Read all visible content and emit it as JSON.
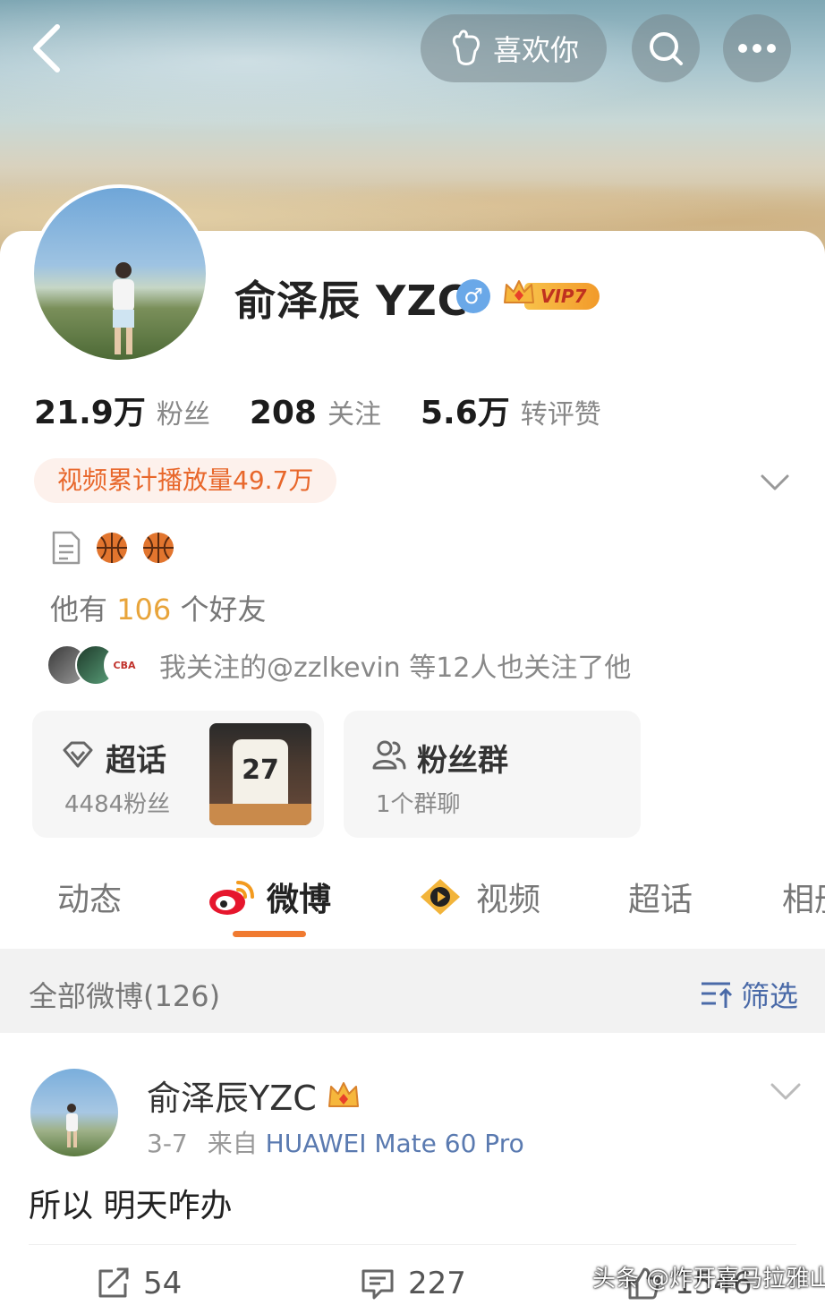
{
  "header": {
    "like_label": "喜欢你"
  },
  "profile": {
    "name": "俞泽辰 YZC",
    "gender_symbol": "♂",
    "vip_label": "VIP7",
    "stats": [
      {
        "num": "21.9万",
        "label": "粉丝"
      },
      {
        "num": "208",
        "label": "关注"
      },
      {
        "num": "5.6万",
        "label": "转评赞"
      }
    ],
    "play_tag": "视频累计播放量49.7万",
    "friends_prefix": "他有 ",
    "friends_count": "106",
    "friends_suffix": " 个好友",
    "mutual_text": "我关注的@zzlkevin 等12人也关注了他",
    "mutual_badge": "CBA"
  },
  "cards": {
    "super_topic": {
      "title": "超话",
      "sub": "4484粉丝",
      "jersey_number": "27"
    },
    "fan_group": {
      "title": "粉丝群",
      "sub": "1个群聊"
    }
  },
  "tabs": [
    {
      "label": "动态"
    },
    {
      "label": "微博"
    },
    {
      "label": "视频"
    },
    {
      "label": "超话"
    },
    {
      "label": "相册"
    }
  ],
  "filterbar": {
    "all_label": "全部微博(126)",
    "filter_label": "筛选"
  },
  "post": {
    "author": "俞泽辰YZC",
    "date": "3-7",
    "source_prefix": "来自 ",
    "source": "HUAWEI Mate 60 Pro",
    "text": "所以 明天咋办",
    "reposts": "54",
    "comments": "227",
    "likes": "1546"
  },
  "watermark": "头条 @炸开喜马拉雅山",
  "colors": {
    "accent": "#f07a30",
    "link": "#4a6aa8",
    "play_tag_text": "#e8672b",
    "friend_count": "#e8a43a"
  }
}
